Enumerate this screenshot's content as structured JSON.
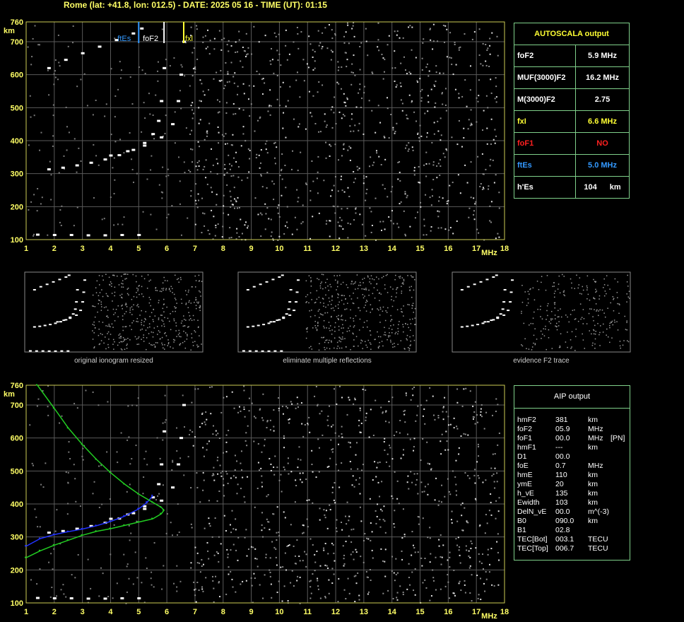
{
  "header": {
    "title": "Rome (lat: +41.8, lon: 012.5) - DATE: 2025 05 16 - TIME (UT): 01:15"
  },
  "chart_data": [
    {
      "type": "scatter",
      "title": "",
      "x_unit": "MHz",
      "y_unit": "km",
      "xlim": [
        1,
        18
      ],
      "ylim": [
        100,
        760
      ],
      "x_ticks": [
        "1",
        "2",
        "3",
        "4",
        "5",
        "6",
        "7",
        "8",
        "9",
        "10",
        "11",
        "12",
        "13",
        "14",
        "15",
        "16",
        "17",
        "18"
      ],
      "y_ticks": [
        "760",
        "700",
        "600",
        "500",
        "400",
        "300",
        "200",
        "100"
      ],
      "markers": [
        {
          "name": "ftEs",
          "x": 5.0,
          "color": "#3399ff"
        },
        {
          "name": "foF2",
          "x": 5.9,
          "color": "#ffffff"
        },
        {
          "name": "fxl",
          "x": 6.6,
          "color": "#ffff33"
        }
      ],
      "series": [
        {
          "name": "F2 trace (o)",
          "color": "#ffffff",
          "x": [
            1.8,
            2.3,
            2.8,
            3.3,
            3.8,
            4.3,
            4.8,
            5.2,
            5.5,
            5.7,
            5.8,
            5.9
          ],
          "y": [
            313,
            318,
            325,
            333,
            343,
            356,
            372,
            393,
            420,
            460,
            520,
            620
          ]
        },
        {
          "name": "F2 trace (x)",
          "color": "#ffffff",
          "x": [
            4.0,
            4.6,
            5.2,
            5.8,
            6.2,
            6.4,
            6.5,
            6.6
          ],
          "y": [
            355,
            368,
            385,
            410,
            450,
            520,
            600,
            700
          ]
        },
        {
          "name": "Es",
          "color": "#ffffff",
          "x": [
            1.4,
            2.0,
            2.6,
            3.2,
            3.8,
            4.4,
            5.0
          ],
          "y": [
            115,
            114,
            114,
            113,
            113,
            114,
            114
          ]
        },
        {
          "name": "second hop",
          "color": "#ffffff",
          "x": [
            1.8,
            2.4,
            3.0,
            3.6,
            4.2,
            4.8,
            5.1
          ],
          "y": [
            620,
            645,
            665,
            685,
            705,
            725,
            740
          ]
        }
      ]
    },
    {
      "type": "scatter",
      "title": "",
      "x_unit": "MHz",
      "y_unit": "km",
      "xlim": [
        1,
        18
      ],
      "ylim": [
        100,
        760
      ],
      "x_ticks": [
        "1",
        "2",
        "3",
        "4",
        "5",
        "6",
        "7",
        "8",
        "9",
        "10",
        "11",
        "12",
        "13",
        "14",
        "15",
        "16",
        "17",
        "18"
      ],
      "y_ticks": [
        "760",
        "700",
        "600",
        "500",
        "400",
        "300",
        "200",
        "100"
      ],
      "series": [
        {
          "name": "F2 trace (o)",
          "color": "#ffffff",
          "x": [
            1.8,
            2.3,
            2.8,
            3.3,
            3.8,
            4.3,
            4.8,
            5.2,
            5.5,
            5.7,
            5.8,
            5.9
          ],
          "y": [
            313,
            318,
            325,
            333,
            343,
            356,
            372,
            393,
            420,
            460,
            520,
            620
          ]
        },
        {
          "name": "F2 trace (x)",
          "color": "#ffffff",
          "x": [
            4.0,
            4.6,
            5.2,
            5.8,
            6.2,
            6.4,
            6.5,
            6.6
          ],
          "y": [
            355,
            368,
            385,
            410,
            450,
            520,
            600,
            700
          ]
        },
        {
          "name": "Es",
          "color": "#ffffff",
          "x": [
            1.4,
            2.0,
            2.6,
            3.2,
            3.8,
            4.4,
            5.0
          ],
          "y": [
            115,
            114,
            114,
            113,
            113,
            114,
            114
          ]
        },
        {
          "name": "AIP virtual height",
          "color": "#2233ff",
          "x": [
            1.0,
            1.5,
            2.0,
            2.5,
            3.0,
            3.5,
            4.0,
            4.5,
            5.0,
            5.3,
            5.5
          ],
          "y": [
            272,
            295,
            307,
            316,
            324,
            334,
            347,
            363,
            385,
            405,
            425
          ]
        },
        {
          "name": "AIP true height profile",
          "color": "#22cc22",
          "x": [
            1.4,
            2.0,
            2.5,
            3.0,
            3.5,
            4.0,
            4.5,
            5.0,
            5.5,
            5.8,
            5.9,
            5.8,
            5.5,
            5.0,
            4.5,
            4.0,
            3.5,
            3.0,
            2.5,
            2.0,
            1.5,
            1.0
          ],
          "y": [
            760,
            690,
            630,
            580,
            535,
            495,
            460,
            430,
            405,
            390,
            381,
            370,
            355,
            345,
            335,
            325,
            317,
            305,
            290,
            275,
            258,
            237
          ]
        }
      ]
    }
  ],
  "autoscala": {
    "title": "AUTOSCALA output",
    "rows": [
      {
        "label": "foF2",
        "value": "5.9 MHz",
        "color": "#ffffff"
      },
      {
        "label": "MUF(3000)F2",
        "value": "16.2 MHz",
        "color": "#ffffff"
      },
      {
        "label": "M(3000)F2",
        "value": "2.75",
        "color": "#ffffff"
      },
      {
        "label": "fxI",
        "value": "6.6 MHz",
        "color": "#ffff33"
      },
      {
        "label": "foF1",
        "value": "NO",
        "color": "#ff2020"
      },
      {
        "label": "ftEs",
        "value": "5.0 MHz",
        "color": "#3399ff"
      },
      {
        "label": "h'Es",
        "value": "104",
        "unit": "km",
        "color": "#ffffff"
      }
    ]
  },
  "thumbnails": [
    {
      "caption": "original ionogram resized"
    },
    {
      "caption": "eliminate multiple reflections"
    },
    {
      "caption": "evidence F2 trace"
    }
  ],
  "aip": {
    "title": "AIP output",
    "rows": [
      {
        "name": "hmF2",
        "value": "381",
        "unit": "km",
        "extra": ""
      },
      {
        "name": "foF2",
        "value": "05.9",
        "unit": "MHz",
        "extra": ""
      },
      {
        "name": "foF1",
        "value": "00.0",
        "unit": "MHz",
        "extra": "[PN]"
      },
      {
        "name": "hmF1",
        "value": "---",
        "unit": "km",
        "extra": ""
      },
      {
        "name": "D1",
        "value": "00.0",
        "unit": "",
        "extra": ""
      },
      {
        "name": "foE",
        "value": "0.7",
        "unit": "MHz",
        "extra": ""
      },
      {
        "name": "hmE",
        "value": "110",
        "unit": "km",
        "extra": ""
      },
      {
        "name": "ymE",
        "value": "20",
        "unit": "km",
        "extra": ""
      },
      {
        "name": "h_vE",
        "value": "135",
        "unit": "km",
        "extra": ""
      },
      {
        "name": "Ewidth",
        "value": "103",
        "unit": "km",
        "extra": ""
      },
      {
        "name": "DelN_vE",
        "value": "00.0",
        "unit": "m^(-3)",
        "extra": ""
      },
      {
        "name": "B0",
        "value": "090.0",
        "unit": "km",
        "extra": ""
      },
      {
        "name": "B1",
        "value": "02.8",
        "unit": "",
        "extra": ""
      },
      {
        "name": "TEC[Bot]",
        "value": "003.1",
        "unit": "TECU",
        "extra": ""
      },
      {
        "name": "TEC[Top]",
        "value": "006.7",
        "unit": "TECU",
        "extra": ""
      }
    ]
  }
}
